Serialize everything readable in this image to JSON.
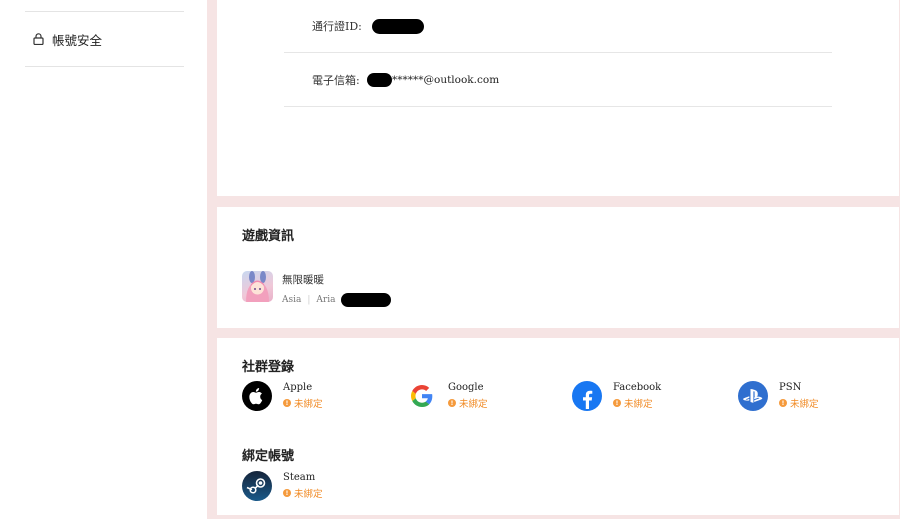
{
  "sidebar": {
    "items": [
      {
        "label": "帳號安全",
        "icon": "lock-icon"
      }
    ]
  },
  "account": {
    "rows": [
      {
        "label": "通行證ID:",
        "value": ""
      },
      {
        "label": "電子信箱:",
        "value": "******@outlook.com"
      }
    ]
  },
  "game_info": {
    "title": "遊戲資訊",
    "games": [
      {
        "name": "無限暖暖",
        "region": "Asia",
        "server": "Aria"
      }
    ]
  },
  "social_login": {
    "title": "社群登錄",
    "items": [
      {
        "name": "Apple",
        "status": "未綁定",
        "icon": "apple-icon"
      },
      {
        "name": "Google",
        "status": "未綁定",
        "icon": "google-icon"
      },
      {
        "name": "Facebook",
        "status": "未綁定",
        "icon": "facebook-icon"
      },
      {
        "name": "PSN",
        "status": "未綁定",
        "icon": "playstation-icon"
      }
    ]
  },
  "bind_accounts": {
    "title": "綁定帳號",
    "items": [
      {
        "name": "Steam",
        "status": "未綁定",
        "icon": "steam-icon"
      }
    ]
  },
  "colors": {
    "unbound_status": "#f08a24",
    "facebook": "#1877f2",
    "psn": "#2f6fcf",
    "steam": "#1b3a57"
  }
}
